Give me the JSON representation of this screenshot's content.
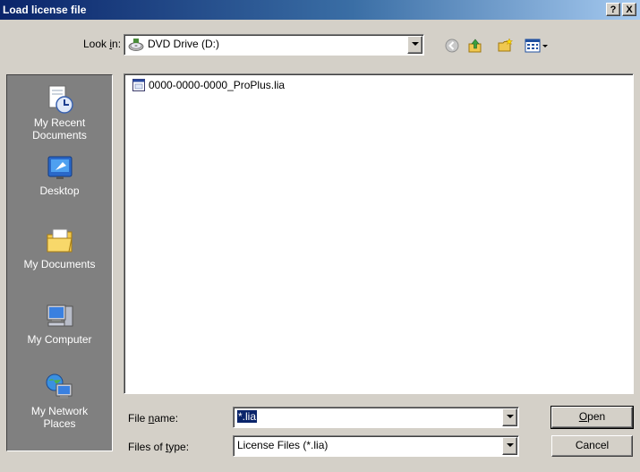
{
  "window": {
    "title": "Load license file",
    "help_label": "?",
    "close_label": "X"
  },
  "lookin": {
    "label_pre": "Look ",
    "label_accel": "i",
    "label_post": "n:",
    "value": "DVD Drive (D:)"
  },
  "toolbar": {
    "icons": [
      "back-icon",
      "up-folder-icon",
      "new-folder-icon",
      "view-menu-icon"
    ]
  },
  "places": [
    {
      "label_line1": "My Recent",
      "label_line2": "Documents",
      "icon": "recent-documents-icon"
    },
    {
      "label_line1": "Desktop",
      "label_line2": "",
      "icon": "desktop-icon"
    },
    {
      "label_line1": "My Documents",
      "label_line2": "",
      "icon": "my-documents-icon"
    },
    {
      "label_line1": "My Computer",
      "label_line2": "",
      "icon": "my-computer-icon"
    },
    {
      "label_line1": "My Network",
      "label_line2": "Places",
      "icon": "network-places-icon"
    }
  ],
  "files": [
    {
      "name": "0000-0000-0000_ProPlus.lia",
      "icon": "license-file-icon"
    }
  ],
  "filename": {
    "label_pre": "File ",
    "label_accel": "n",
    "label_post": "ame:",
    "value": "*.lia"
  },
  "filetype": {
    "label_pre": "Files of ",
    "label_accel": "t",
    "label_post": "ype:",
    "value": "License Files (*.lia)"
  },
  "buttons": {
    "open_accel": "O",
    "open_rest": "pen",
    "cancel": "Cancel"
  },
  "colors": {
    "title_start": "#0a246a",
    "title_end": "#a6caf0",
    "face": "#d4d0c8",
    "places_bg": "#808080",
    "selection": "#0a246a"
  }
}
